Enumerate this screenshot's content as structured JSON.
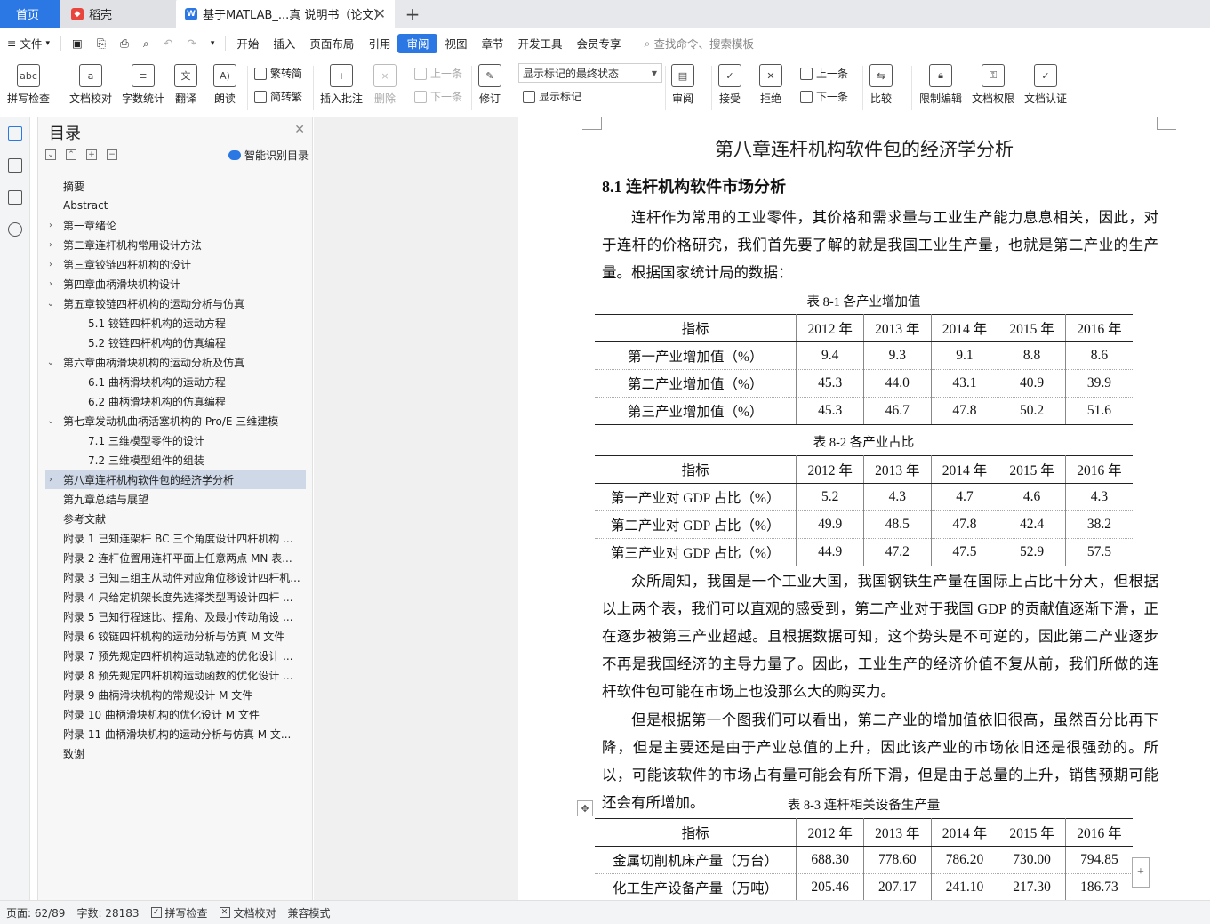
{
  "tabs": {
    "home": "首页",
    "wps": "稻壳",
    "doc": "基于MATLAB_...真 说明书（论文）",
    "close": "✕",
    "add": "+"
  },
  "menu": {
    "file": "文件",
    "items": [
      "开始",
      "插入",
      "页面布局",
      "引用",
      "审阅",
      "视图",
      "章节",
      "开发工具",
      "会员专享"
    ],
    "active": "审阅",
    "search": "查找命令、搜索模板"
  },
  "ribbon": {
    "spell_check": "拼写检查",
    "doc_proof": "文档校对",
    "word_count": "字数统计",
    "translate": "翻译",
    "read_aloud": "朗读",
    "to_traditional": "繁转简",
    "to_simplified": "简转繁",
    "insert_comment": "插入批注",
    "delete": "删除",
    "prev": "上一条",
    "next": "下一条",
    "revise": "修订",
    "markup_combo": "显示标记的最终状态",
    "show_markup": "显示标记",
    "review": "审阅",
    "accept": "接受",
    "reject": "拒绝",
    "prev2": "上一条",
    "next2": "下一条",
    "compare": "比较",
    "restrict_edit": "限制编辑",
    "doc_permission": "文档权限",
    "doc_cert": "文档认证"
  },
  "toc": {
    "title": "目录",
    "smart": "智能识别目录",
    "items": [
      {
        "label": "摘要",
        "level": 0,
        "expander": ""
      },
      {
        "label": "Abstract",
        "level": 0,
        "expander": ""
      },
      {
        "label": "第一章绪论",
        "level": 0,
        "expander": ">"
      },
      {
        "label": "第二章连杆机构常用设计方法",
        "level": 0,
        "expander": ">"
      },
      {
        "label": "第三章铰链四杆机构的设计",
        "level": 0,
        "expander": ">"
      },
      {
        "label": "第四章曲柄滑块机构设计",
        "level": 0,
        "expander": ">"
      },
      {
        "label": "第五章铰链四杆机构的运动分析与仿真",
        "level": 0,
        "expander": "v"
      },
      {
        "label": "5.1  铰链四杆机构的运动方程",
        "level": 1,
        "expander": ""
      },
      {
        "label": "5.2 铰链四杆机构的仿真编程",
        "level": 1,
        "expander": ""
      },
      {
        "label": "第六章曲柄滑块机构的运动分析及仿真",
        "level": 0,
        "expander": "v"
      },
      {
        "label": "6.1  曲柄滑块机构的运动方程",
        "level": 1,
        "expander": ""
      },
      {
        "label": "6.2 曲柄滑块机构的仿真编程",
        "level": 1,
        "expander": ""
      },
      {
        "label": "第七章发动机曲柄活塞机构的 Pro/E 三维建模",
        "level": 0,
        "expander": "v"
      },
      {
        "label": "7.1  三维模型零件的设计",
        "level": 1,
        "expander": ""
      },
      {
        "label": "7.2 三维模型组件的组装",
        "level": 1,
        "expander": ""
      },
      {
        "label": "第八章连杆机构软件包的经济学分析",
        "level": 0,
        "expander": ">",
        "selected": true
      },
      {
        "label": "第九章总结与展望",
        "level": 0,
        "expander": ""
      },
      {
        "label": "参考文献",
        "level": 0,
        "expander": ""
      },
      {
        "label": "附录 1 已知连架杆 BC 三个角度设计四杆机构 ...",
        "level": 0,
        "expander": ""
      },
      {
        "label": "附录 2  连杆位置用连杆平面上任意两点 MN 表...",
        "level": 0,
        "expander": ""
      },
      {
        "label": "附录 3 已知三组主从动件对应角位移设计四杆机...",
        "level": 0,
        "expander": ""
      },
      {
        "label": "附录 4  只给定机架长度先选择类型再设计四杆 ...",
        "level": 0,
        "expander": ""
      },
      {
        "label": "附录 5  已知行程速比、摆角、及最小传动角设 ...",
        "level": 0,
        "expander": ""
      },
      {
        "label": "附录 6  铰链四杆机构的运动分析与仿真 M 文件",
        "level": 0,
        "expander": ""
      },
      {
        "label": "附录 7  预先规定四杆机构运动轨迹的优化设计 ...",
        "level": 0,
        "expander": ""
      },
      {
        "label": "附录 8  预先规定四杆机构运动函数的优化设计 ...",
        "level": 0,
        "expander": ""
      },
      {
        "label": "附录 9  曲柄滑块机构的常规设计 M 文件",
        "level": 0,
        "expander": ""
      },
      {
        "label": "附录 10  曲柄滑块机构的优化设计 M 文件",
        "level": 0,
        "expander": ""
      },
      {
        "label": "附录 11  曲柄滑块机构的运动分析与仿真 M 文...",
        "level": 0,
        "expander": ""
      },
      {
        "label": "致谢",
        "level": 0,
        "expander": ""
      }
    ]
  },
  "doc": {
    "chapter_title": "第八章连杆机构软件包的经济学分析",
    "section_title": "8.1  连杆机构软件市场分析",
    "para1": "连杆作为常用的工业零件，其价格和需求量与工业生产能力息息相关，因此，对于连杆的价格研究，我们首先要了解的就是我国工业生产量，也就是第二产业的生产量。根据国家统计局的数据：",
    "table1_caption": "表 8-1  各产业增加值",
    "table1": [
      [
        "指标",
        "2012 年",
        "2013 年",
        "2014 年",
        "2015 年",
        "2016 年"
      ],
      [
        "第一产业增加值（%）",
        "9.4",
        "9.3",
        "9.1",
        "8.8",
        "8.6"
      ],
      [
        "第二产业增加值（%）",
        "45.3",
        "44.0",
        "43.1",
        "40.9",
        "39.9"
      ],
      [
        "第三产业增加值（%）",
        "45.3",
        "46.7",
        "47.8",
        "50.2",
        "51.6"
      ]
    ],
    "table2_caption": "表 8-2  各产业占比",
    "table2": [
      [
        "指标",
        "2012 年",
        "2013 年",
        "2014 年",
        "2015 年",
        "2016 年"
      ],
      [
        "第一产业对 GDP 占比（%）",
        "5.2",
        "4.3",
        "4.7",
        "4.6",
        "4.3"
      ],
      [
        "第二产业对 GDP 占比（%）",
        "49.9",
        "48.5",
        "47.8",
        "42.4",
        "38.2"
      ],
      [
        "第三产业对 GDP 占比（%）",
        "44.9",
        "47.2",
        "47.5",
        "52.9",
        "57.5"
      ]
    ],
    "para2": "众所周知，我国是一个工业大国，我国钢铁生产量在国际上占比十分大，但根据以上两个表，我们可以直观的感受到，第二产业对于我国 GDP 的贡献值逐渐下滑，正在逐步被第三产业超越。且根据数据可知，这个势头是不可逆的，因此第二产业逐步不再是我国经济的主导力量了。因此，工业生产的经济价值不复从前，我们所做的连杆软件包可能在市场上也没那么大的购买力。",
    "para3": "但是根据第一个图我们可以看出，第二产业的增加值依旧很高，虽然百分比再下降，但是主要还是由于产业总值的上升，因此该产业的市场依旧还是很强劲的。所以，可能该软件的市场占有量可能会有所下滑，但是由于总量的上升，销售预期可能还会有所增加。",
    "table3_caption": "表 8-3  连杆相关设备生产量",
    "table3": [
      [
        "指标",
        "2012 年",
        "2013 年",
        "2014 年",
        "2015 年",
        "2016 年"
      ],
      [
        "金属切削机床产量（万台）",
        "688.30",
        "778.60",
        "786.20",
        "730.00",
        "794.85"
      ],
      [
        "化工生产设备产量（万吨）",
        "205.46",
        "207.17",
        "241.10",
        "217.30",
        "186.73"
      ]
    ]
  },
  "status": {
    "page": "页面: 62/89",
    "words": "字数: 28183",
    "spell": "拼写检查",
    "proof": "文档校对",
    "compat": "兼容模式"
  }
}
